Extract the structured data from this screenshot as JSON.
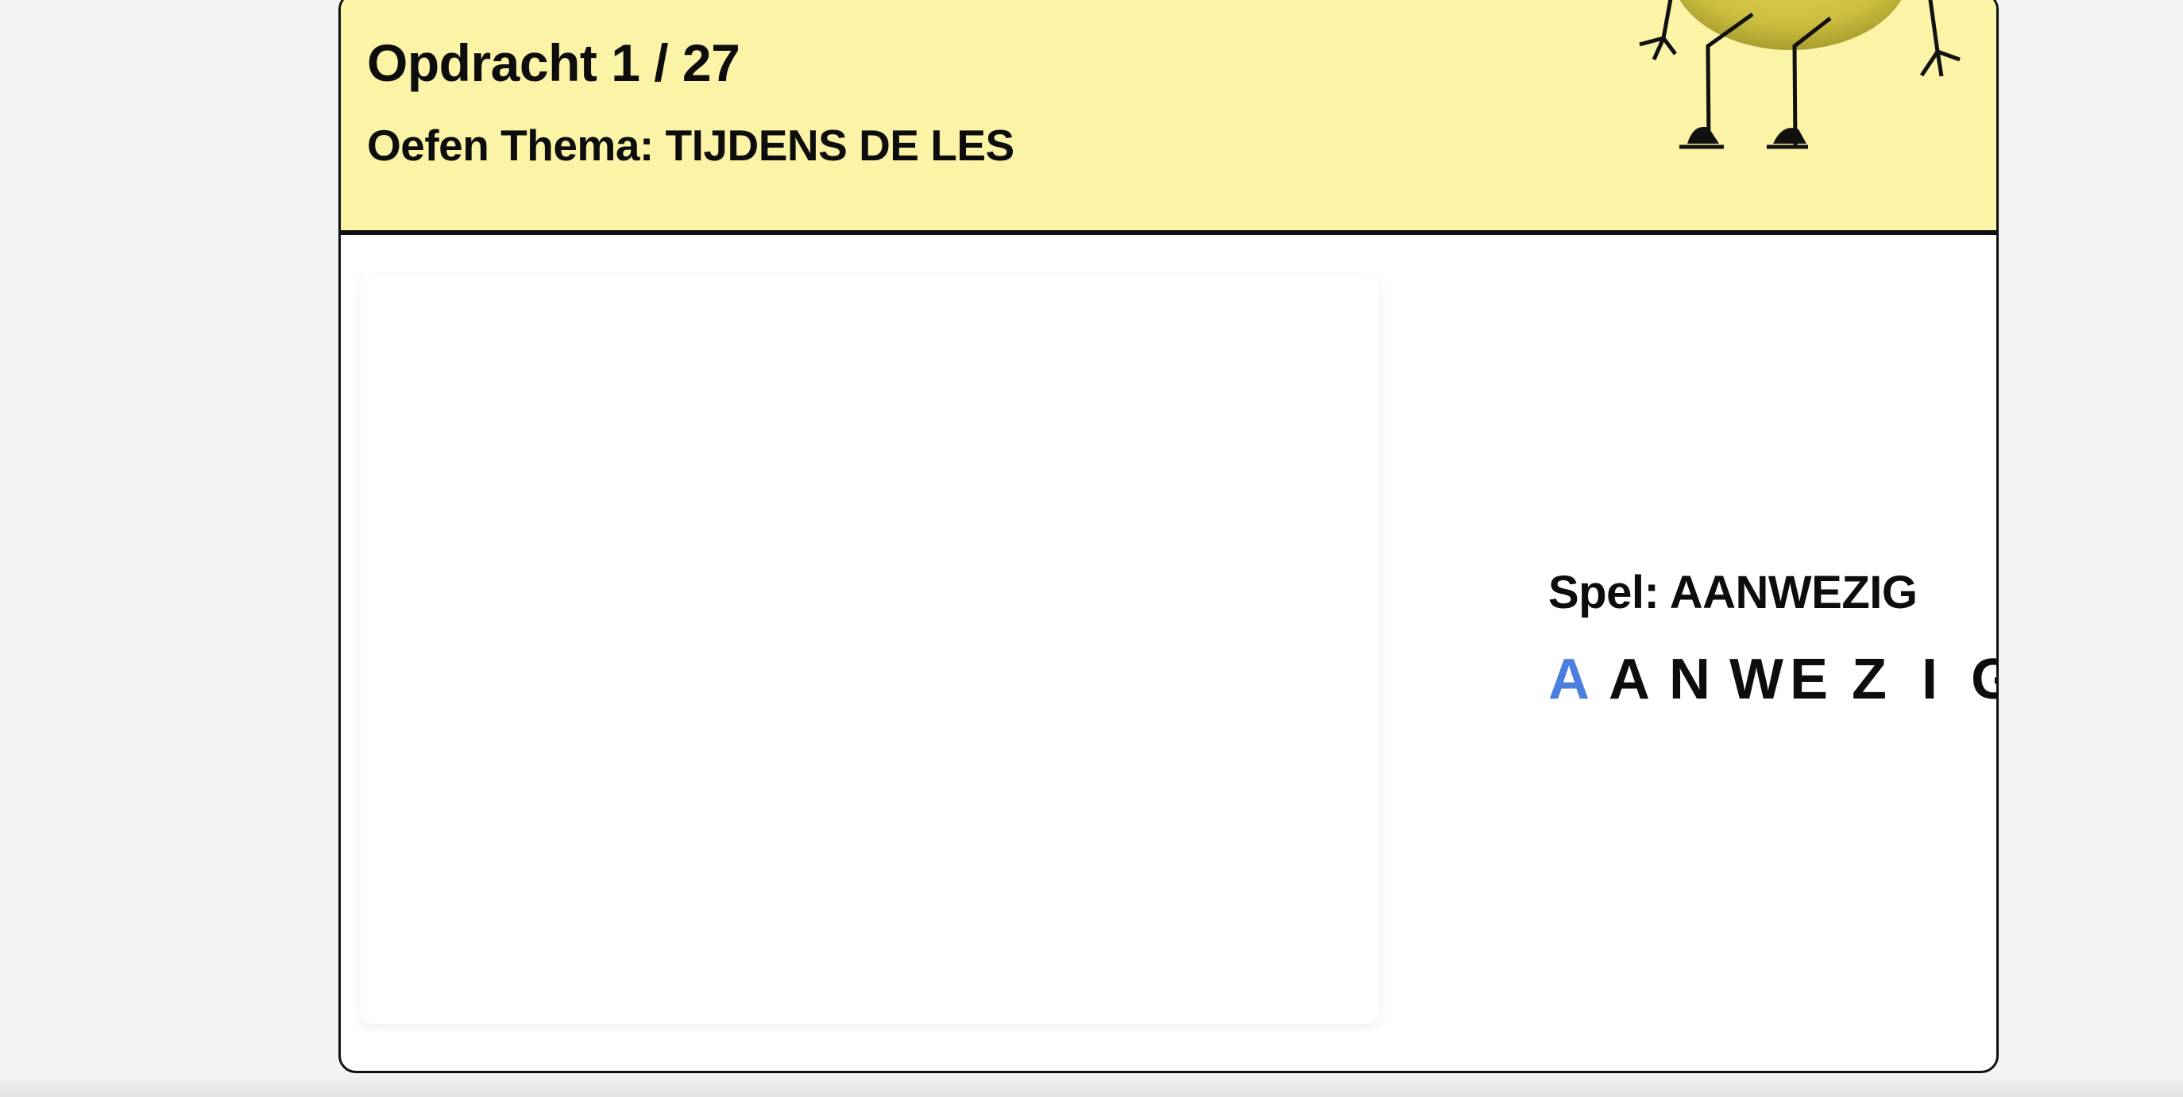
{
  "header": {
    "title": "Opdracht 1 / 27",
    "subtitle": "Oefen Thema: TIJDENS DE LES",
    "background_color": "#fbf3a6"
  },
  "mascot": {
    "icon": "mascot-creature-icon"
  },
  "game": {
    "label": "Spel: AANWEZIG",
    "letters": [
      "A",
      "A",
      "N",
      "W",
      "E",
      "Z",
      "I",
      "G"
    ],
    "active_letter_color": "#4a7fe0"
  }
}
